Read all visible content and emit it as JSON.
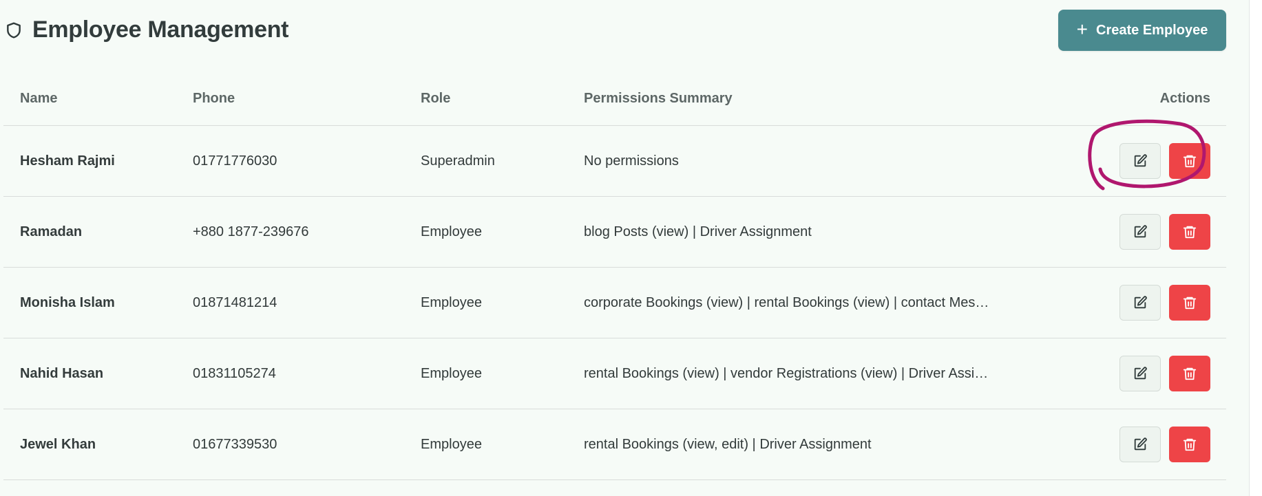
{
  "header": {
    "title": "Employee Management",
    "title_icon": "shield-icon",
    "create_button": {
      "label": "Create Employee",
      "icon": "plus-icon"
    }
  },
  "table": {
    "columns": {
      "name": "Name",
      "phone": "Phone",
      "role": "Role",
      "permissions": "Permissions Summary",
      "actions": "Actions"
    },
    "rows": [
      {
        "name": "Hesham Rajmi",
        "phone": "01771776030",
        "role": "Superadmin",
        "permissions": "No permissions"
      },
      {
        "name": "Ramadan",
        "phone": "+880 1877-239676",
        "role": "Employee",
        "permissions": "blog Posts (view) | Driver Assignment"
      },
      {
        "name": "Monisha Islam",
        "phone": "01871481214",
        "role": "Employee",
        "permissions": "corporate Bookings (view) | rental Bookings (view) | contact Mes…"
      },
      {
        "name": "Nahid Hasan",
        "phone": "01831105274",
        "role": "Employee",
        "permissions": "rental Bookings (view) | vendor Registrations (view) | Driver Assi…"
      },
      {
        "name": "Jewel Khan",
        "phone": "01677339530",
        "role": "Employee",
        "permissions": "rental Bookings (view, edit) | Driver Assignment"
      }
    ],
    "row_actions": {
      "edit_icon": "edit-icon",
      "delete_icon": "trash-icon"
    }
  },
  "colors": {
    "background": "#f6fbf7",
    "primary": "#4a8a8f",
    "danger": "#ee4447",
    "annotation": "#b0176e"
  }
}
